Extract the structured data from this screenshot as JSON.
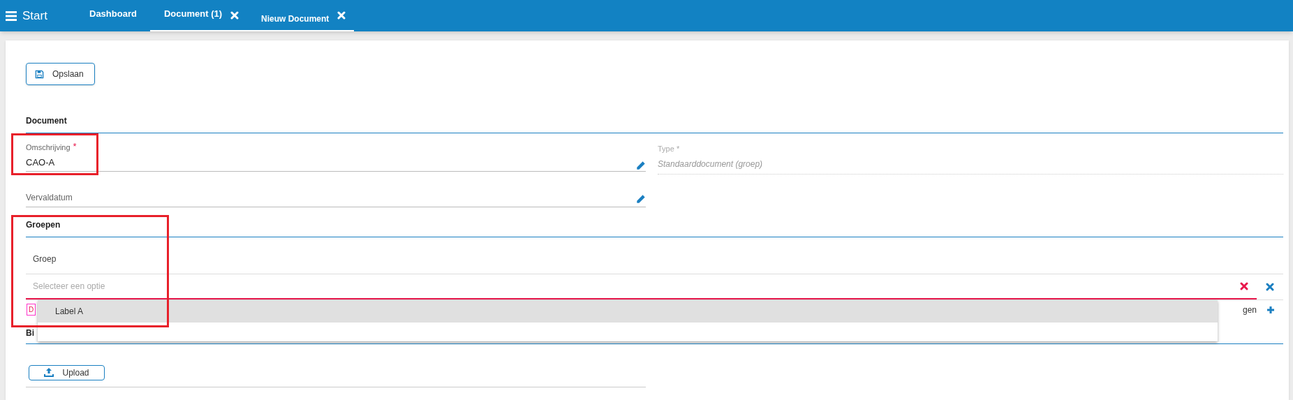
{
  "nav": {
    "title": "Start",
    "tabs": [
      {
        "label": "Dashboard",
        "closable": false,
        "selected": false,
        "underlined": false
      },
      {
        "label": "Document (1)",
        "closable": true,
        "selected": false,
        "underlined": true
      },
      {
        "label": "Nieuw Document",
        "closable": true,
        "selected": true,
        "underlined": true
      }
    ]
  },
  "save_button": "Opslaan",
  "document_section": {
    "title": "Document",
    "description": {
      "label": "Omschrijving",
      "required_mark": "*",
      "value": "CAO-A"
    },
    "type": {
      "label": "Type *",
      "value": "Standaarddocument (groep)"
    },
    "expiry": {
      "label": "Vervaldatum"
    }
  },
  "groups_section": {
    "title": "Groepen",
    "group_label": "Groep",
    "select": {
      "placeholder": "Selecteer een optie",
      "invalid": true
    },
    "error_text": "D",
    "add_text": "gen",
    "dropdown": [
      {
        "label": "Label A",
        "selected": true
      }
    ]
  },
  "attachments_section": {
    "title": "Bi",
    "upload_button": "Upload"
  }
}
